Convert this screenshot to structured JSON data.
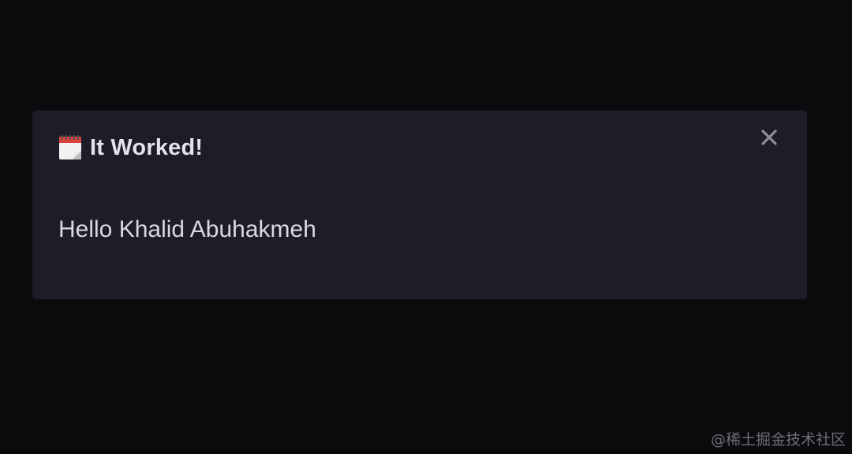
{
  "dialog": {
    "title": "It Worked!",
    "title_icon": "calendar-icon",
    "message": "Hello Khalid Abuhakmeh",
    "close_icon": "close-icon"
  },
  "watermark": "@稀土掘金技术社区",
  "colors": {
    "background": "#0a0b0d",
    "dialog_background": "#1c1d28",
    "title_text": "#e3e4ea",
    "body_text": "#d8d9e0",
    "close_icon": "#8d8e97"
  }
}
